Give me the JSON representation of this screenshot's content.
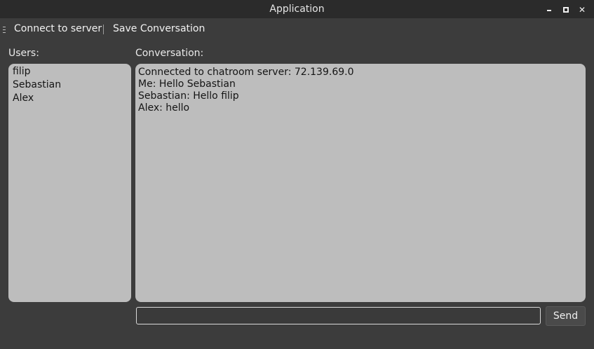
{
  "window": {
    "title": "Application",
    "minimize_icon": "minimize-icon",
    "maximize_icon": "maximize-icon",
    "close_icon": "close-icon"
  },
  "menu": {
    "grip_icon": "toolbar-grip-icon",
    "items": [
      {
        "label": "Connect to server"
      },
      {
        "label": "Save Conversation"
      }
    ]
  },
  "users": {
    "label": "Users:",
    "items": [
      "filip",
      "Sebastian",
      "Alex"
    ]
  },
  "conversation": {
    "label": "Conversation:",
    "messages": [
      "Connected to chatroom server: 72.139.69.0",
      "Me: Hello Sebastian",
      "Sebastian: Hello filip",
      "Alex: hello"
    ]
  },
  "composer": {
    "input_value": "",
    "send_label": "Send"
  },
  "colors": {
    "background": "#3c3c3c",
    "titlebar": "#2b2b2b",
    "panel": "#bdbdbd"
  }
}
